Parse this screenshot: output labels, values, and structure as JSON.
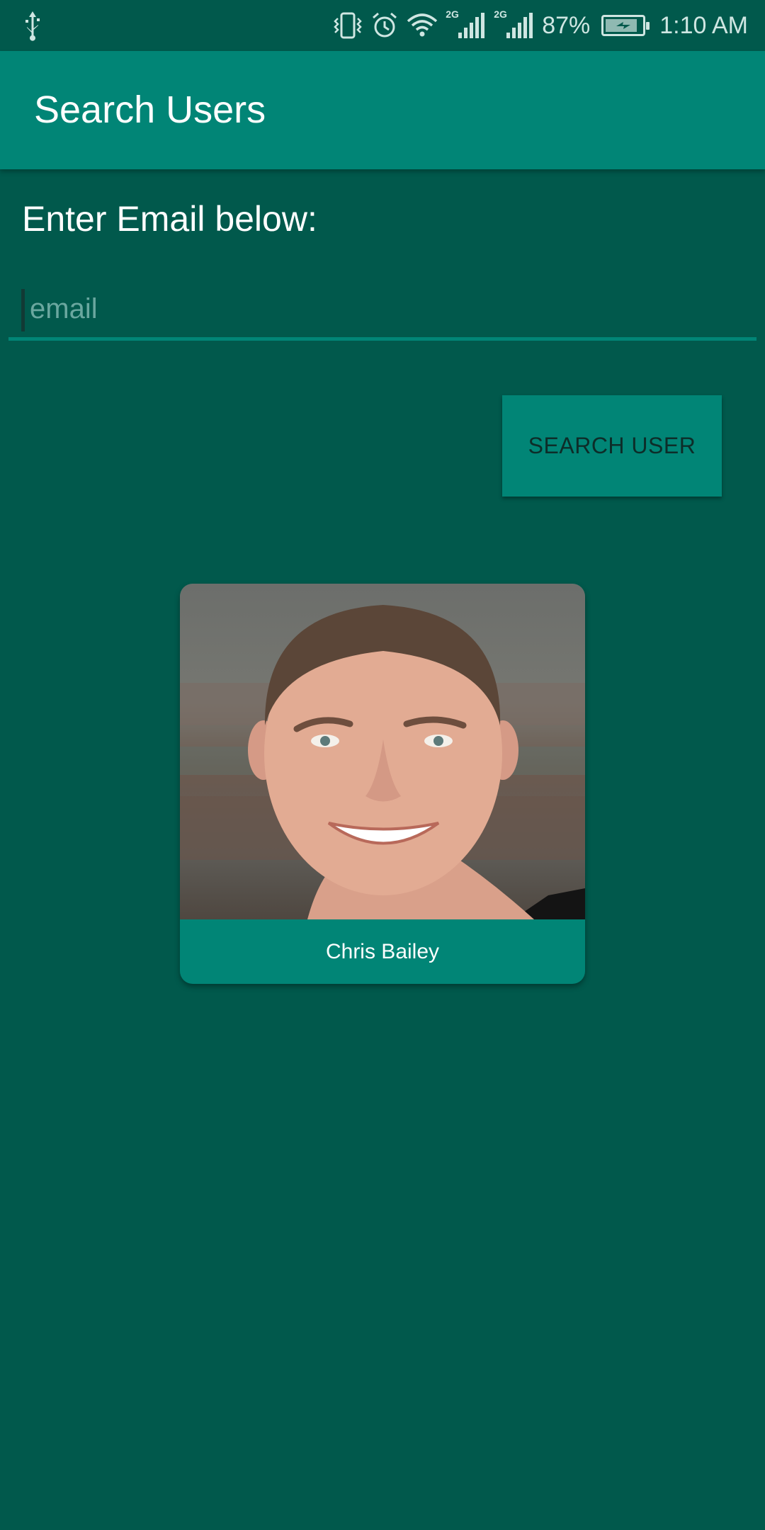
{
  "status_bar": {
    "battery_percent_text": "87%",
    "time": "1:10 AM",
    "network_tag_1": "2G",
    "network_tag_2": "2G",
    "battery_level": 0.87,
    "icons": [
      "usb-icon",
      "vibrate-icon",
      "alarm-icon",
      "wifi-icon",
      "signal-icon",
      "signal-icon",
      "battery-charging-icon"
    ]
  },
  "app_bar": {
    "title": "Search Users"
  },
  "form": {
    "prompt": "Enter Email below:",
    "email_placeholder": "email",
    "email_value": "",
    "search_button_label": "SEARCH USER"
  },
  "result": {
    "name": "Chris Bailey",
    "photo": "user-photo"
  },
  "colors": {
    "background": "#01594c",
    "app_bar": "#018576",
    "accent": "#018576",
    "text": "#ffffff"
  }
}
